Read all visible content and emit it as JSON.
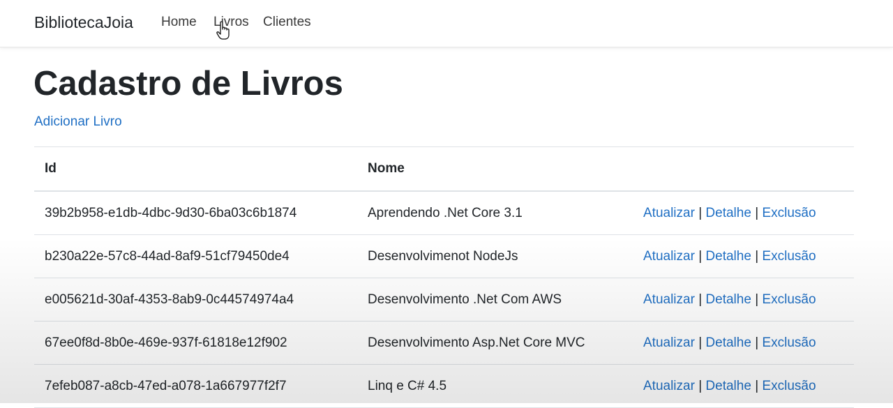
{
  "navbar": {
    "brand": "BibliotecaJoia",
    "links": [
      "Home",
      "Livros",
      "Clientes"
    ]
  },
  "page": {
    "title": "Cadastro de Livros",
    "add_link": "Adicionar Livro"
  },
  "table": {
    "headers": [
      "Id",
      "Nome",
      ""
    ],
    "action_labels": {
      "update": "Atualizar",
      "detail": "Detalhe",
      "delete": "Exclusão",
      "separator": "|"
    },
    "rows": [
      {
        "id": "39b2b958-e1db-4dbc-9d30-6ba03c6b1874",
        "nome": "Aprendendo .Net Core 3.1"
      },
      {
        "id": "b230a22e-57c8-44ad-8af9-51cf79450de4",
        "nome": "Desenvolvimenot NodeJs"
      },
      {
        "id": "e005621d-30af-4353-8ab9-0c44574974a4",
        "nome": "Desenvolvimento .Net Com AWS"
      },
      {
        "id": "67ee0f8d-8b0e-469e-937f-61818e12f902",
        "nome": "Desenvolvimento Asp.Net Core MVC"
      },
      {
        "id": "7efeb087-a8cb-47ed-a078-1a667977f2f7",
        "nome": "Linq e C# 4.5"
      }
    ]
  },
  "colors": {
    "link": "#1f6fc4",
    "text": "#212529",
    "border": "#dee2e6"
  }
}
